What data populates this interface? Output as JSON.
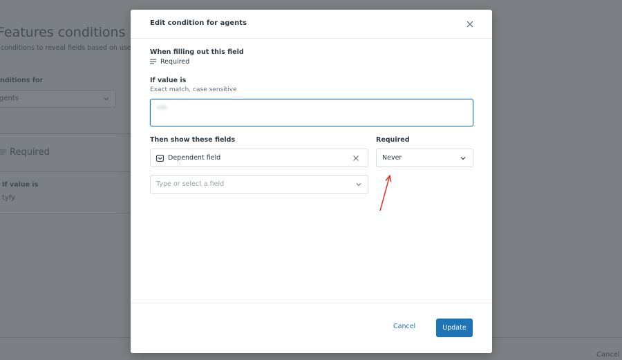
{
  "background": {
    "title": "Features conditions",
    "subtitle": "conditions to reveal fields based on user inp",
    "conditions_for_label": "nditions for",
    "conditions_for_value": "gents",
    "required_label": "Required",
    "if_value_label": "If value is",
    "if_value_value": "tyfy",
    "cancel_label": "Cancel"
  },
  "modal": {
    "title": "Edit condition for agents",
    "when_label": "When filling out this field",
    "when_field": "Required",
    "if_value_label": "If value is",
    "if_value_hint": "Exact match, case sensitive",
    "if_value_input": "vds",
    "then_label": "Then show these fields",
    "required_label": "Required",
    "dependent_field": "Dependent field",
    "required_value": "Never",
    "add_field_placeholder": "Type or select a field",
    "cancel_label": "Cancel",
    "update_label": "Update"
  },
  "colors": {
    "accent": "#1f73b7",
    "annotation_arrow": "#e03c31"
  },
  "icons": {
    "close": "close-icon",
    "field_type": "lines-icon",
    "dependent_field_type": "dropdown-field-icon",
    "remove": "remove-icon",
    "chevron": "chevron-down-icon"
  }
}
